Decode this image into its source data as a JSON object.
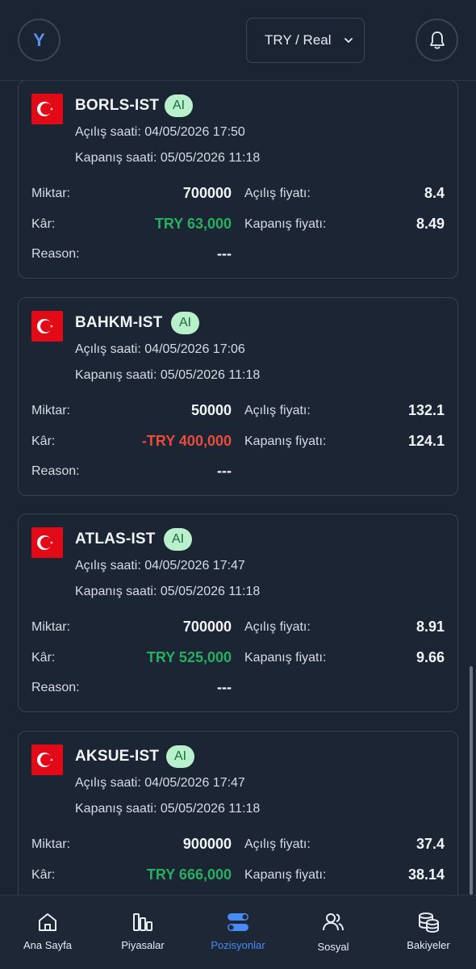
{
  "header": {
    "avatar_initial": "Y",
    "currency_selector": "TRY / Real"
  },
  "labels": {
    "opening_time": "Açılış saati:",
    "closing_time": "Kapanış saati:",
    "quantity": "Miktar:",
    "profit": "Kâr:",
    "reason": "Reason:",
    "opening_price": "Açılış fiyatı:",
    "closing_price": "Kapanış fiyatı:"
  },
  "positions": [
    {
      "symbol": "BORLS-IST",
      "badge": "AI",
      "opened": "04/05/2026 17:50",
      "closed": "05/05/2026 11:18",
      "quantity": "700000",
      "profit": "TRY 63,000",
      "reason": "---",
      "open_price": "8.4",
      "close_price": "8.49"
    },
    {
      "symbol": "BAHKM-IST",
      "badge": "AI",
      "opened": "04/05/2026 17:06",
      "closed": "05/05/2026 11:18",
      "quantity": "50000",
      "profit": "-TRY 400,000",
      "reason": "---",
      "open_price": "132.1",
      "close_price": "124.1"
    },
    {
      "symbol": "ATLAS-IST",
      "badge": "AI",
      "opened": "04/05/2026 17:47",
      "closed": "05/05/2026 11:18",
      "quantity": "700000",
      "profit": "TRY 525,000",
      "reason": "---",
      "open_price": "8.91",
      "close_price": "9.66"
    },
    {
      "symbol": "AKSUE-IST",
      "badge": "AI",
      "opened": "04/05/2026 17:47",
      "closed": "05/05/2026 11:18",
      "quantity": "900000",
      "profit": "TRY 666,000",
      "reason": "---",
      "open_price": "37.4",
      "close_price": "38.14"
    }
  ],
  "nav": [
    {
      "label": "Ana Sayfa",
      "icon": "home-icon"
    },
    {
      "label": "Piyasalar",
      "icon": "bar-chart-icon"
    },
    {
      "label": "Pozisyonlar",
      "icon": "toggle-icon",
      "active": true
    },
    {
      "label": "Sosyal",
      "icon": "users-icon"
    },
    {
      "label": "Bakiyeler",
      "icon": "coins-icon"
    }
  ],
  "colors": {
    "background": "#1b2433",
    "profit_positive": "#27ae60",
    "profit_negative": "#e74c3c",
    "accent": "#4a8af4",
    "badge_bg": "#b8f0cc"
  }
}
